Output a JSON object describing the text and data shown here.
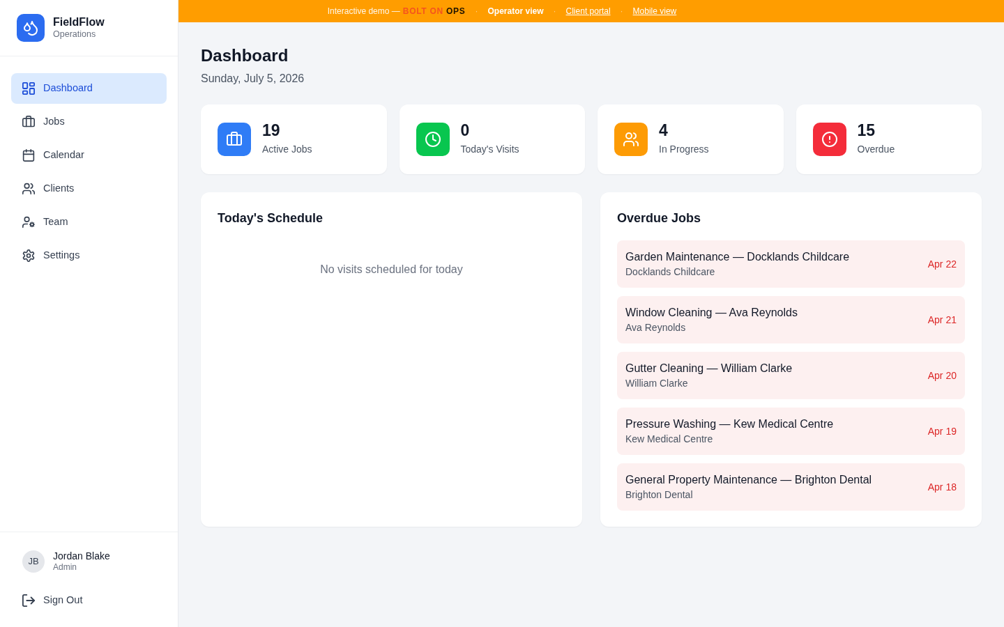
{
  "banner": {
    "intro": "Interactive demo —",
    "brand": [
      {
        "text": "BOLT ON",
        "kind": "accent"
      },
      {
        "text": "OPS",
        "kind": "plain"
      }
    ],
    "links": [
      {
        "separator": "·",
        "label": "Operator view",
        "selected": true
      },
      {
        "separator": "·",
        "label": "Client portal",
        "selected": false
      },
      {
        "separator": "·",
        "label": "Mobile view",
        "selected": false
      }
    ]
  },
  "sidebar": {
    "brand": {
      "name": "FieldFlow",
      "subtitle": "Operations"
    },
    "items": [
      {
        "label": "Dashboard",
        "selected": true
      },
      {
        "label": "Jobs",
        "selected": false
      },
      {
        "label": "Calendar",
        "selected": false
      },
      {
        "label": "Clients",
        "selected": false
      },
      {
        "label": "Team",
        "selected": false
      },
      {
        "label": "Settings",
        "selected": false
      }
    ],
    "user": {
      "initials": "JB",
      "name": "Jordan Blake",
      "role": "Admin"
    },
    "sign_out": "Sign Out"
  },
  "page": {
    "title": "Dashboard",
    "date": "Sunday, July 5, 2026"
  },
  "stats": [
    {
      "value": "19",
      "label": "Active Jobs",
      "color": "#2f7cf6"
    },
    {
      "value": "0",
      "label": "Today's Visits",
      "color": "#08c64f"
    },
    {
      "value": "4",
      "label": "In Progress",
      "color": "#fd9b05"
    },
    {
      "value": "15",
      "label": "Overdue",
      "color": "#f42c3a"
    }
  ],
  "schedule": {
    "title": "Today's Schedule",
    "empty_message": "No visits scheduled for today"
  },
  "overdue": {
    "title": "Overdue Jobs",
    "jobs": [
      {
        "title": "Garden Maintenance — Docklands Childcare",
        "client": "Docklands Childcare",
        "due": "Apr 22"
      },
      {
        "title": "Window Cleaning — Ava Reynolds",
        "client": "Ava Reynolds",
        "due": "Apr 21"
      },
      {
        "title": "Gutter Cleaning — William Clarke",
        "client": "William Clarke",
        "due": "Apr 20"
      },
      {
        "title": "Pressure Washing — Kew Medical Centre",
        "client": "Kew Medical Centre",
        "due": "Apr 19"
      },
      {
        "title": "General Property Maintenance — Brighton Dental",
        "client": "Brighton Dental",
        "due": "Apr 18"
      }
    ]
  }
}
